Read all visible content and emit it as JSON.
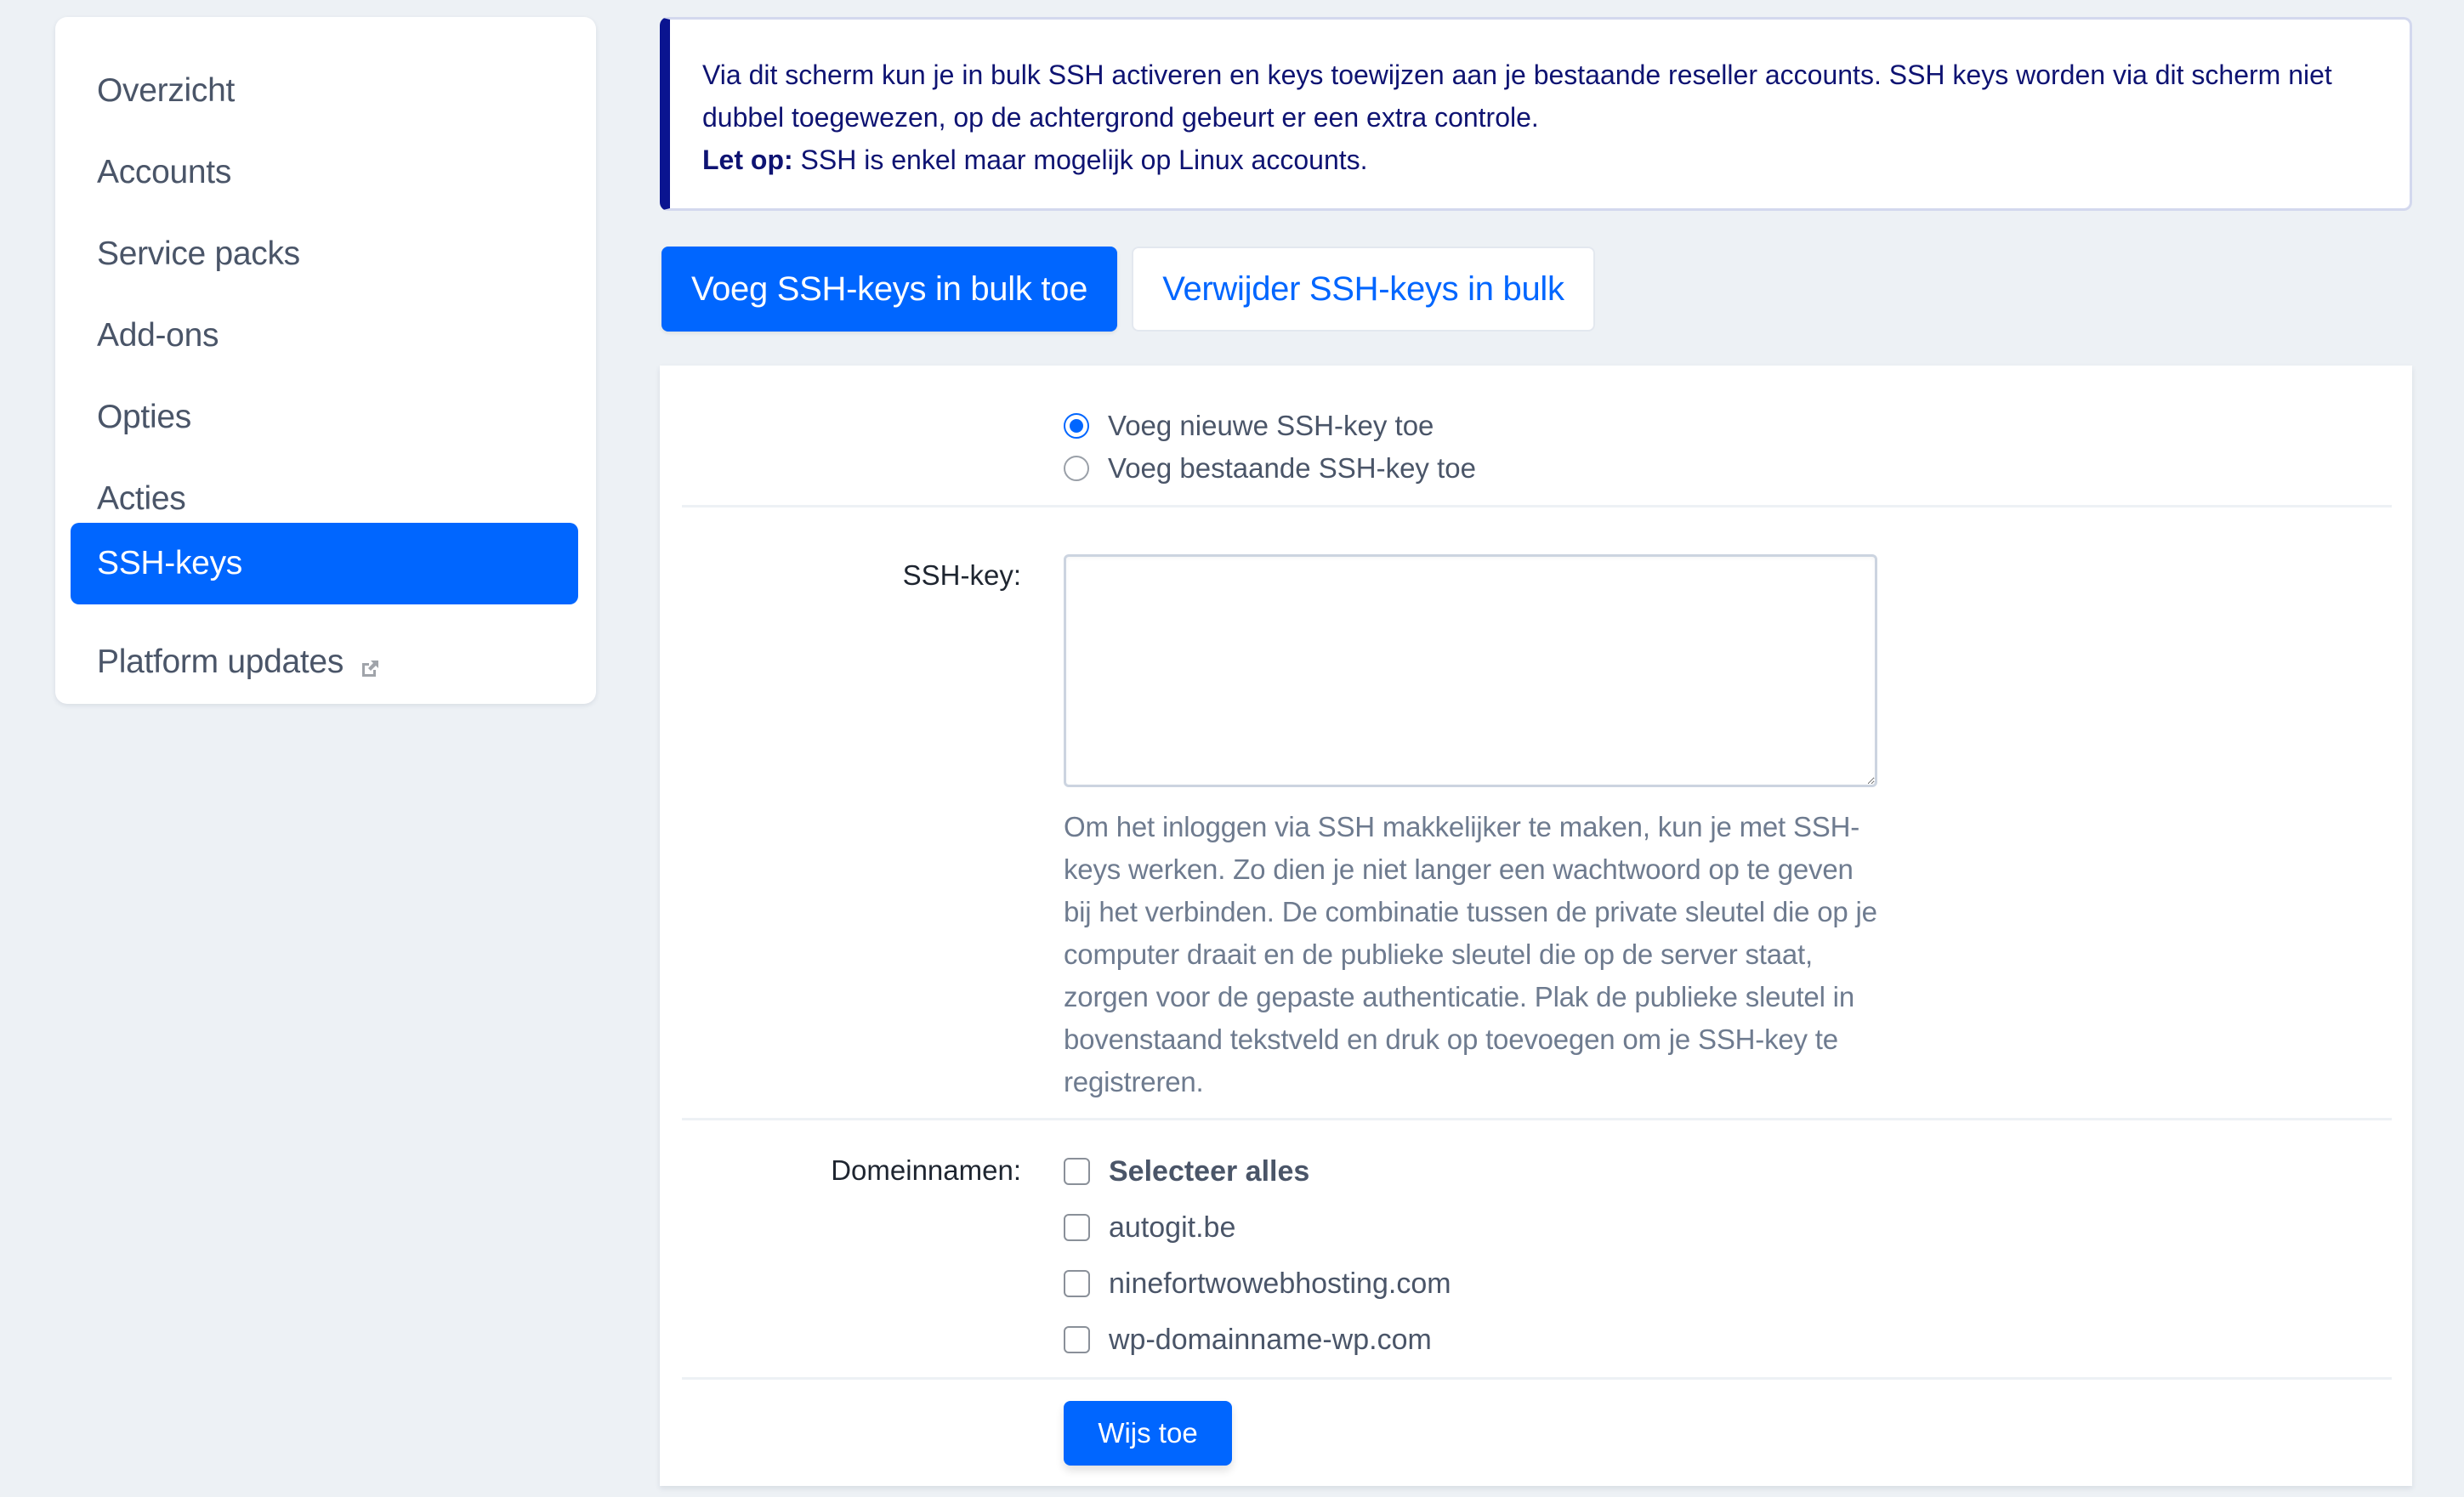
{
  "sidebar": {
    "items": [
      {
        "label": "Overzicht",
        "active": false
      },
      {
        "label": "Accounts",
        "active": false
      },
      {
        "label": "Service packs",
        "active": false
      },
      {
        "label": "Add-ons",
        "active": false
      },
      {
        "label": "Opties",
        "active": false
      },
      {
        "label": "Acties",
        "active": false
      },
      {
        "label": "SSH-keys",
        "active": true
      },
      {
        "label": "Platform updates",
        "active": false,
        "icon": "external-link-icon"
      }
    ]
  },
  "info": {
    "text": "Via dit scherm kun je in bulk SSH activeren en keys toewijzen aan je bestaande reseller accounts. SSH keys worden via dit scherm niet dubbel toegewezen, op de achtergrond gebeurt er een extra controle.",
    "note_label": "Let op:",
    "note_text": " SSH is enkel maar mogelijk op Linux accounts."
  },
  "tabs": {
    "add_label": "Voeg SSH-keys in bulk toe",
    "remove_label": "Verwijder SSH-keys in bulk"
  },
  "form": {
    "radio_options": [
      {
        "label": "Voeg nieuwe SSH-key toe",
        "checked": true
      },
      {
        "label": "Voeg bestaande SSH-key toe",
        "checked": false
      }
    ],
    "ssh_key_label": "SSH-key:",
    "ssh_key_value": "",
    "help_text": "Om het inloggen via SSH makkelijker te maken, kun je met SSH-keys werken. Zo dien je niet langer een wachtwoord op te geven bij het verbinden. De combinatie tussen de private sleutel die op je computer draait en de publieke sleutel die op de server staat, zorgen voor de gepaste authenticatie. Plak de publieke sleutel in bovenstaand tekstveld en druk op toevoegen om je SSH-key te registreren.",
    "domains_label": "Domeinnamen:",
    "select_all_label": "Selecteer alles",
    "domains": [
      {
        "name": "autogit.be",
        "checked": false
      },
      {
        "name": "ninefortwowebhosting.com",
        "checked": false
      },
      {
        "name": "wp-domainname-wp.com",
        "checked": false
      }
    ],
    "submit_label": "Wijs toe"
  },
  "colors": {
    "accent": "#0066ff",
    "info_border": "#0a1490",
    "info_text": "#0e1372",
    "background": "#edf1f5"
  }
}
